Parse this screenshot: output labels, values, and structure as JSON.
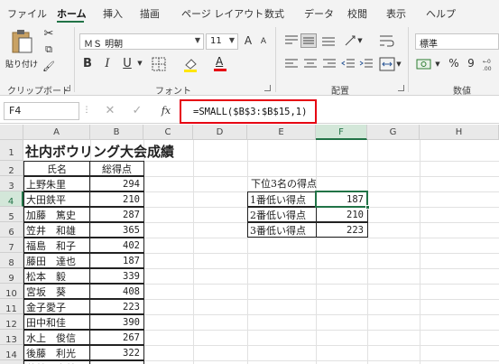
{
  "ribbon_tabs": [
    "ファイル",
    "ホーム",
    "挿入",
    "描画",
    "ページ レイアウト",
    "数式",
    "データ",
    "校閲",
    "表示",
    "ヘルプ"
  ],
  "ribbon": {
    "paste_label": "貼り付け",
    "font_name": "ＭＳ 明朝",
    "font_size": "11",
    "number_format": "標準",
    "groups": {
      "clipboard": "クリップボード",
      "font": "フォント",
      "alignment": "配置",
      "number": "数値"
    },
    "bold": "B",
    "italic": "I",
    "underline": "U",
    "font_color_glyph": "A",
    "grow_font": "A",
    "shrink_font": "A",
    "percent": "%",
    "comma": "9"
  },
  "formula_bar": {
    "name_box": "F4",
    "fx": "fx",
    "formula": "=SMALL($B$3:$B$15,1)"
  },
  "columns": [
    "A",
    "B",
    "C",
    "D",
    "E",
    "F",
    "G",
    "H"
  ],
  "rows": [
    "1",
    "2",
    "3",
    "4",
    "5",
    "6",
    "7",
    "8",
    "9",
    "10",
    "11",
    "12",
    "13",
    "14",
    "15"
  ],
  "sheet": {
    "title": "社内ボウリング大会成績",
    "header_name": "氏名",
    "header_score": "総得点",
    "players": [
      {
        "name": "上野朱里",
        "score": "294"
      },
      {
        "name": "大田鉄平",
        "score": "210"
      },
      {
        "name": "加藤　篤史",
        "score": "287"
      },
      {
        "name": "笠井　和雄",
        "score": "365"
      },
      {
        "name": "福島　和子",
        "score": "402"
      },
      {
        "name": "藤田　達也",
        "score": "187"
      },
      {
        "name": "松本　毅",
        "score": "339"
      },
      {
        "name": "宮坂　葵",
        "score": "408"
      },
      {
        "name": "金子愛子",
        "score": "223"
      },
      {
        "name": "田中和佳",
        "score": "390"
      },
      {
        "name": "水上　俊信",
        "score": "267"
      },
      {
        "name": "後藤　利光",
        "score": "322"
      },
      {
        "name": "若林　恵美",
        "score": "371"
      }
    ],
    "lowest_title": "下位3名の得点",
    "lowest": [
      {
        "label": "1番低い得点",
        "score": "187"
      },
      {
        "label": "2番低い得点",
        "score": "210"
      },
      {
        "label": "3番低い得点",
        "score": "223"
      }
    ]
  },
  "colors": {
    "accent": "#217346",
    "highlight_box": "#e60012"
  }
}
